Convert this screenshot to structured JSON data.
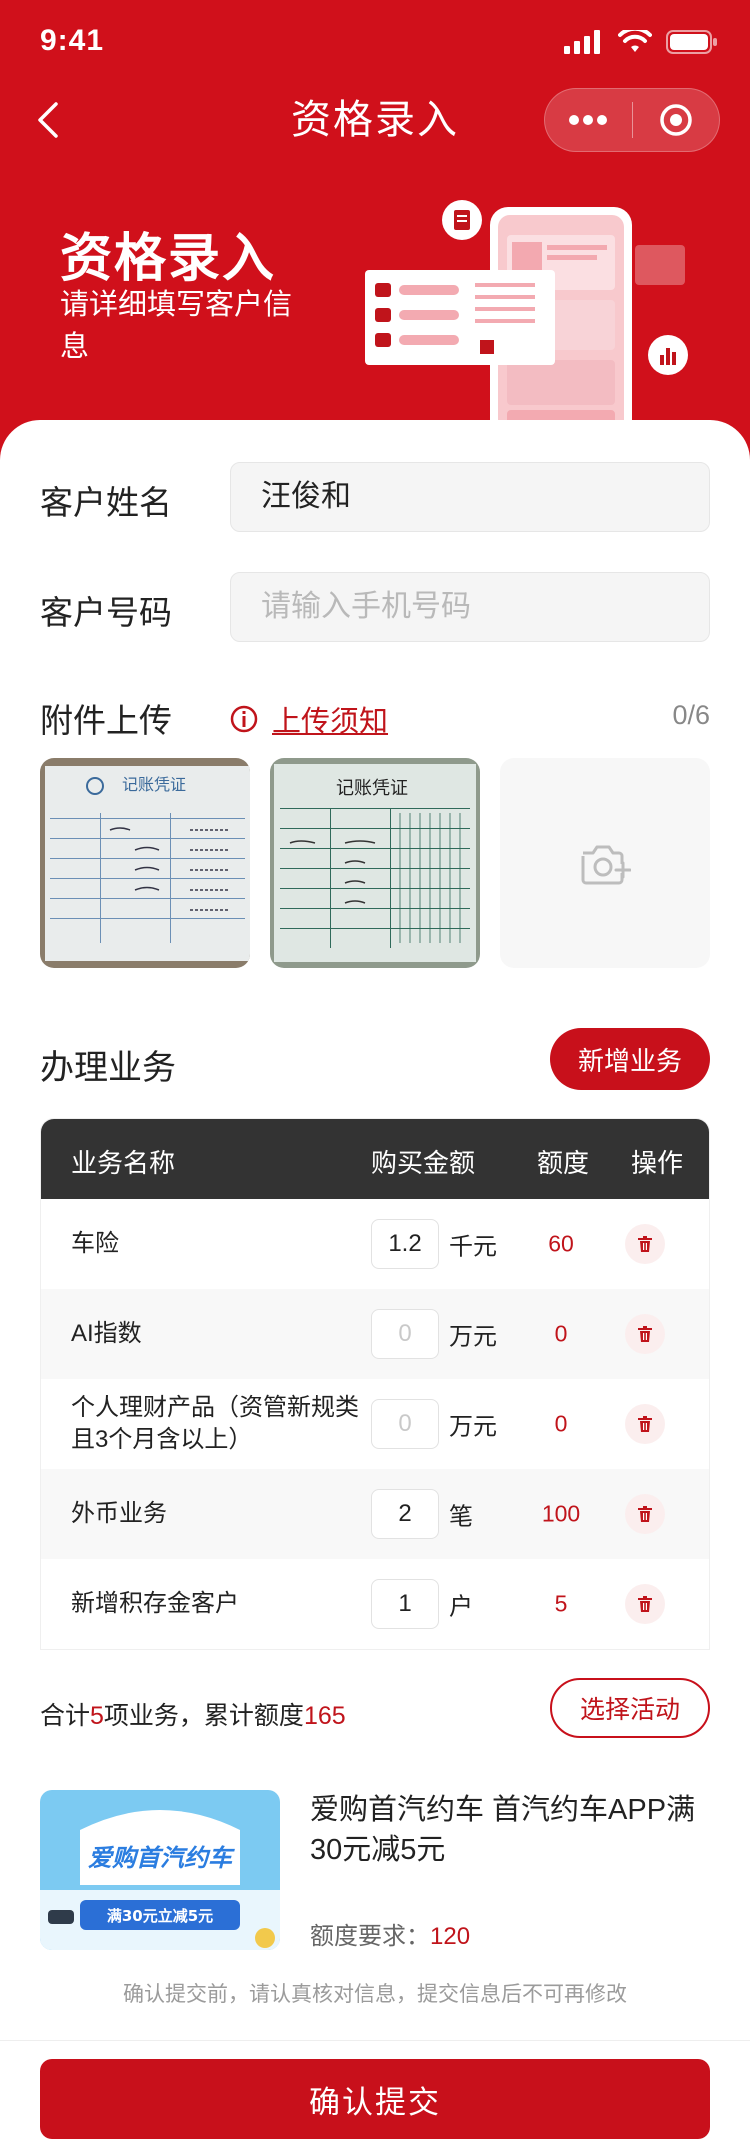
{
  "status_bar": {
    "time": "9:41"
  },
  "nav": {
    "title": "资格录入"
  },
  "hero": {
    "title": "资格录入",
    "subtitle": "请详细填写客户信息"
  },
  "form": {
    "name_label": "客户姓名",
    "name_value": "汪俊和",
    "phone_label": "客户号码",
    "phone_placeholder": "请输入手机号码"
  },
  "upload": {
    "label": "附件上传",
    "tip": "上传须知",
    "count": "0/6",
    "photos": [
      "记账凭证",
      "记账凭证"
    ]
  },
  "business": {
    "title": "办理业务",
    "add_button": "新增业务",
    "headers": {
      "name": "业务名称",
      "amount": "购买金额",
      "quota": "额度",
      "action": "操作"
    },
    "rows": [
      {
        "name": "车险",
        "qty": "1.2",
        "unit": "千元",
        "quota": "60"
      },
      {
        "name": "AI指数",
        "qty": "0",
        "unit": "万元",
        "quota": "0"
      },
      {
        "name": "个人理财产品（资管新规类且3个月含以上）",
        "qty": "0",
        "unit": "万元",
        "quota": "0"
      },
      {
        "name": "外币业务",
        "qty": "2",
        "unit": "笔",
        "quota": "100"
      },
      {
        "name": "新增积存金客户",
        "qty": "1",
        "unit": "户",
        "quota": "5"
      }
    ]
  },
  "summary": {
    "prefix": "合计",
    "count": "5",
    "middle": "项业务，累计额度",
    "total": "165"
  },
  "activity_button": "选择活动",
  "promo": {
    "banner_text": "爱购首汽约车",
    "banner_sub": "满30元立减5元",
    "title": "爱购首汽约车 首汽约车APP满30元减5元",
    "req_label": "额度要求：",
    "req_value": "120"
  },
  "notice": "确认提交前，请认真核对信息，提交信息后不可再修改",
  "submit": "确认提交",
  "colors": {
    "brand_red": "#d0101b",
    "text_red": "#c0141b",
    "header_dark": "#333333"
  }
}
